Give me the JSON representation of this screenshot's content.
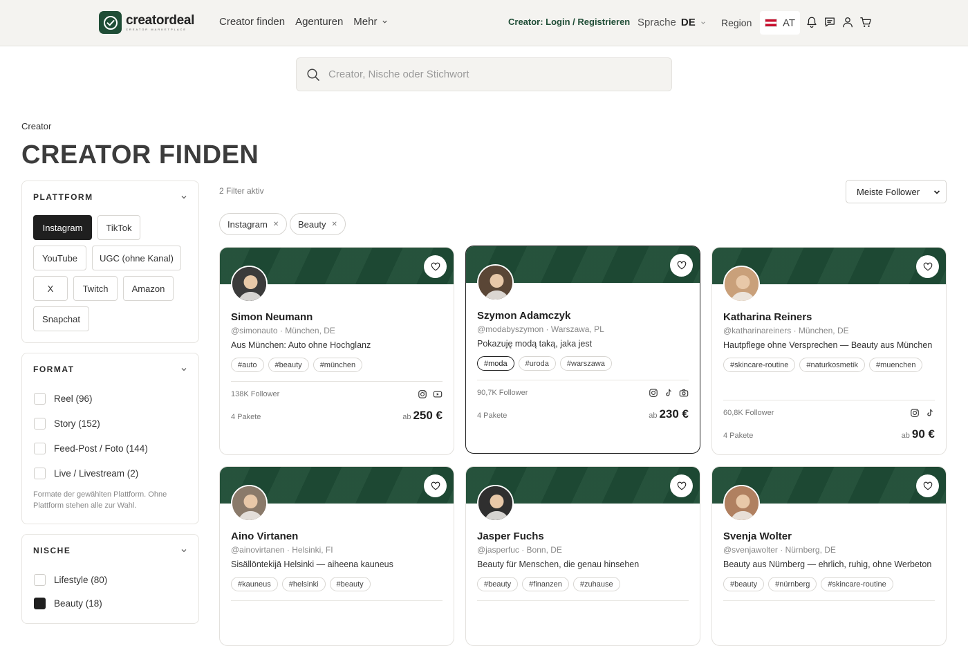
{
  "header": {
    "logo_text": "creatordeal",
    "logo_sub": "CREATOR MARKETPLACE",
    "nav": [
      "Creator finden",
      "Agenturen",
      "Mehr"
    ],
    "login": "Creator: Login / Registrieren",
    "language_label": "Sprache",
    "language_value": "DE",
    "region_label": "Region",
    "country": "AT"
  },
  "search": {
    "placeholder": "Creator, Nische oder Stichwort"
  },
  "breadcrumb": "Creator",
  "page_title": "CREATOR FINDEN",
  "filters": {
    "platform": {
      "title": "PLATTFORM",
      "chips": [
        "Instagram",
        "TikTok",
        "YouTube",
        "UGC (ohne Kanal)",
        "X",
        "Twitch",
        "Amazon",
        "Snapchat"
      ],
      "active": "Instagram"
    },
    "format": {
      "title": "FORMAT",
      "options": [
        "Reel (96)",
        "Story (152)",
        "Feed-Post / Foto (144)",
        "Live / Livestream (2)"
      ],
      "note": "Formate der gewählten Plattform. Ohne Plattform stehen alle zur Wahl."
    },
    "niche": {
      "title": "NISCHE",
      "options": [
        "Lifestyle (80)",
        "Beauty (18)"
      ]
    }
  },
  "results": {
    "active_count": "2 Filter aktiv",
    "sort": "Meiste Follower",
    "active_tags": [
      "Instagram",
      "Beauty"
    ]
  },
  "creators": [
    {
      "name": "Simon Neumann",
      "handle": "@simonauto",
      "location": "München, DE",
      "bio": "Aus München: Auto ohne Hochglanz",
      "tags": [
        "#auto",
        "#beauty",
        "#münchen"
      ],
      "followers": "138K Follower",
      "packages": "4 Pakete",
      "price_prefix": "ab",
      "price": "250 €",
      "icons": [
        "instagram-icon",
        "youtube-icon"
      ]
    },
    {
      "name": "Szymon Adamczyk",
      "handle": "@modabyszymon",
      "location": "Warszawa, PL",
      "bio": "Pokazuję modą taką, jaka jest",
      "tags": [
        "#moda",
        "#uroda",
        "#warszawa"
      ],
      "followers": "90,7K Follower",
      "packages": "4 Pakete",
      "price_prefix": "ab",
      "price": "230 €",
      "icons": [
        "instagram-icon",
        "tiktok-icon",
        "camera-icon"
      ]
    },
    {
      "name": "Katharina Reiners",
      "handle": "@katharinareiners",
      "location": "München, DE",
      "bio": "Hautpflege ohne Versprechen — Beauty aus München",
      "tags": [
        "#skincare-routine",
        "#naturkosmetik",
        "#muenchen"
      ],
      "followers": "60,8K Follower",
      "packages": "4 Pakete",
      "price_prefix": "ab",
      "price": "90 €",
      "icons": [
        "instagram-icon",
        "tiktok-icon"
      ]
    },
    {
      "name": "Aino Virtanen",
      "handle": "@ainovirtanen",
      "location": "Helsinki, FI",
      "bio": "Sisällöntekijä Helsinki — aiheena kauneus",
      "tags": [
        "#kauneus",
        "#helsinki",
        "#beauty"
      ]
    },
    {
      "name": "Jasper Fuchs",
      "handle": "@jasperfuc",
      "location": "Bonn, DE",
      "bio": "Beauty für Menschen, die genau hinsehen",
      "tags": [
        "#beauty",
        "#finanzen",
        "#zuhause"
      ]
    },
    {
      "name": "Svenja Wolter",
      "handle": "@svenjawolter",
      "location": "Nürnberg, DE",
      "bio": "Beauty aus Nürnberg — ehrlich, ruhig, ohne Werbeton",
      "tags": [
        "#beauty",
        "#nürnberg",
        "#skincare-routine"
      ]
    }
  ],
  "colors": {
    "brand_green": "#1f4d36",
    "dark": "#1f1f1f"
  }
}
